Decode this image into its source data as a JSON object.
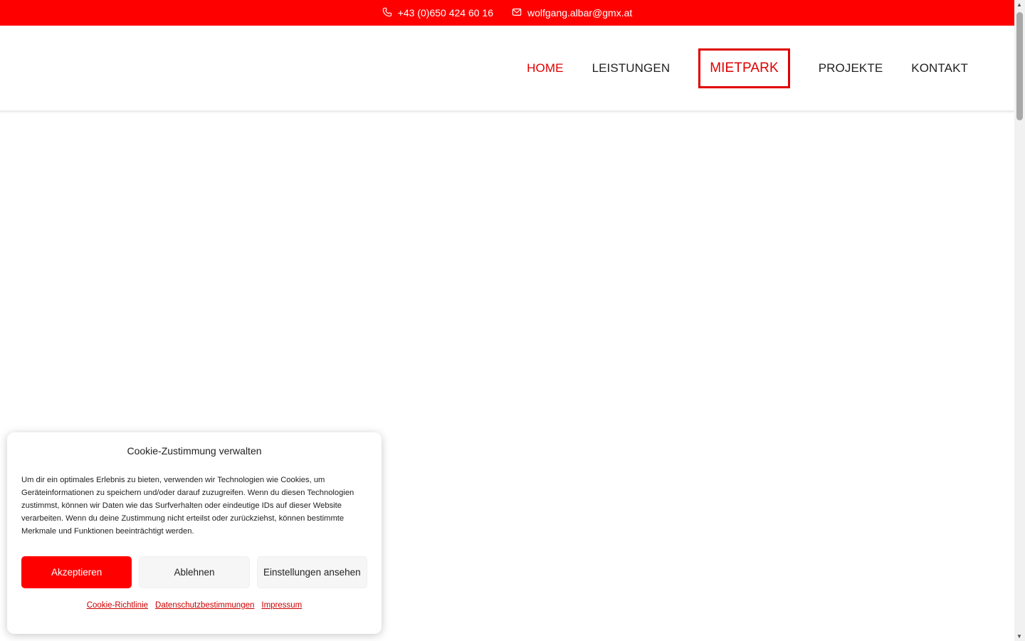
{
  "topbar": {
    "phone": "+43 (0)650 424 60 16",
    "email": "wolfgang.albar@gmx.at",
    "background": "#ff0000"
  },
  "nav": {
    "items": [
      {
        "label": "HOME"
      },
      {
        "label": "LEISTUNGEN"
      },
      {
        "label": "MIETPARK"
      },
      {
        "label": "PROJEKTE"
      },
      {
        "label": "KONTAKT"
      }
    ],
    "accent": "#e00000"
  },
  "cookie": {
    "title": "Cookie-Zustimmung verwalten",
    "text": "Um dir ein optimales Erlebnis zu bieten, verwenden wir Technologien wie Cookies, um Geräteinformationen zu speichern und/oder darauf zuzugreifen. Wenn du diesen Technologien zustimmst, können wir Daten wie das Surfverhalten oder eindeutige IDs auf dieser Website verarbeiten. Wenn du deine Zustimmung nicht erteilst oder zurückziehst, können bestimmte Merkmale und Funktionen beeinträchtigt werden.",
    "accept": "Akzeptieren",
    "deny": "Ablehnen",
    "settings": "Einstellungen ansehen",
    "links": {
      "cookie_policy": "Cookie-Richtlinie",
      "privacy": "Datenschutzbestimmungen",
      "imprint": "Impressum"
    }
  }
}
